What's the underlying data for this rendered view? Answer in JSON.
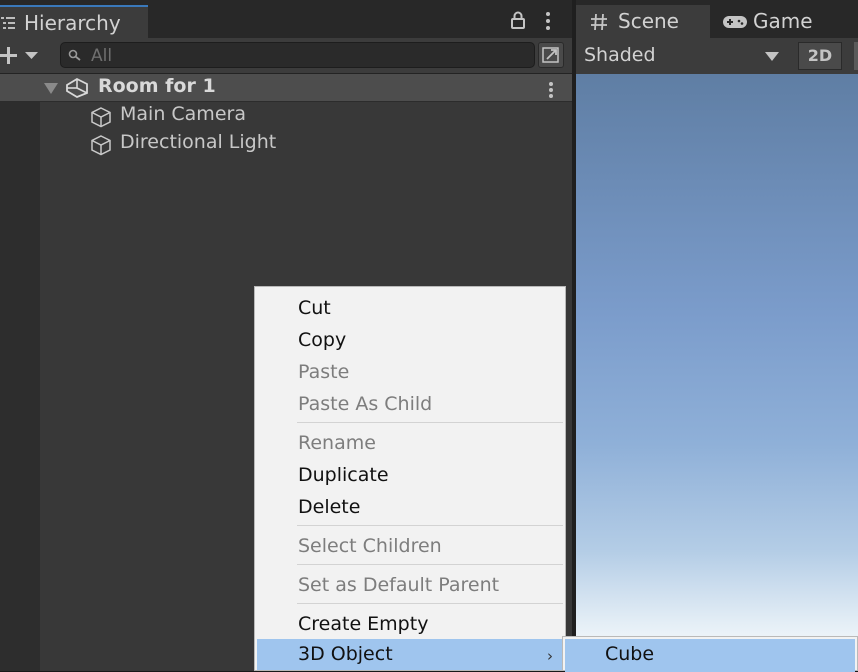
{
  "hierarchy": {
    "tab_label": "Hierarchy",
    "search": {
      "placeholder": "All",
      "value": ""
    },
    "scene": {
      "name": "Room for 1"
    },
    "objects": [
      {
        "label": "Main Camera",
        "icon": "cube-icon"
      },
      {
        "label": "Directional Light",
        "icon": "cube-icon"
      }
    ]
  },
  "scene_view": {
    "tabs": [
      {
        "label": "Scene",
        "icon": "grid-icon",
        "active": true
      },
      {
        "label": "Game",
        "icon": "gamepad-icon",
        "active": false
      }
    ],
    "shading_mode": "Shaded",
    "toggle_2d_label": "2D"
  },
  "context_menu": {
    "items": [
      {
        "label": "Cut",
        "enabled": true
      },
      {
        "label": "Copy",
        "enabled": true
      },
      {
        "label": "Paste",
        "enabled": false
      },
      {
        "label": "Paste As Child",
        "enabled": false
      },
      {
        "label": "Rename",
        "enabled": false
      },
      {
        "label": "Duplicate",
        "enabled": true
      },
      {
        "label": "Delete",
        "enabled": true
      },
      {
        "label": "Select Children",
        "enabled": false
      },
      {
        "label": "Set as Default Parent",
        "enabled": false
      },
      {
        "label": "Create Empty",
        "enabled": true
      },
      {
        "label": "3D Object",
        "enabled": true,
        "highlighted": true,
        "has_submenu": true
      }
    ],
    "submenu_arrow": "›",
    "submenu": {
      "items": [
        {
          "label": "Cube",
          "highlighted": true
        }
      ]
    }
  },
  "colors": {
    "accent": "#3a79bb",
    "menu_highlight": "#9fc5ee",
    "panel_bg": "#383838"
  }
}
